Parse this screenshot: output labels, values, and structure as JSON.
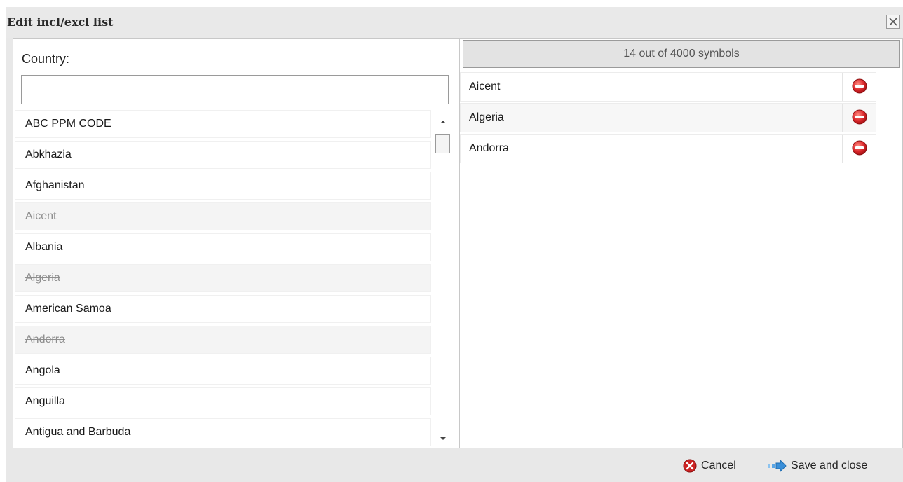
{
  "dialog": {
    "title": "Edit incl/excl list",
    "close_icon": "close-x-icon"
  },
  "left": {
    "filter_label": "Country:",
    "filter_value": "",
    "filter_placeholder": "",
    "items": [
      {
        "label": "ABC PPM CODE",
        "excluded": false
      },
      {
        "label": "Abkhazia",
        "excluded": false
      },
      {
        "label": "Afghanistan",
        "excluded": false
      },
      {
        "label": "Aicent",
        "excluded": true
      },
      {
        "label": "Albania",
        "excluded": false
      },
      {
        "label": "Algeria",
        "excluded": true
      },
      {
        "label": "American Samoa",
        "excluded": false
      },
      {
        "label": "Andorra",
        "excluded": true
      },
      {
        "label": "Angola",
        "excluded": false
      },
      {
        "label": "Anguilla",
        "excluded": false
      },
      {
        "label": "Antigua and Barbuda",
        "excluded": false
      }
    ]
  },
  "right": {
    "count_text": "14 out of 4000 symbols",
    "items": [
      {
        "label": "Aicent"
      },
      {
        "label": "Algeria"
      },
      {
        "label": "Andorra"
      }
    ],
    "remove_icon": "remove-minus-icon"
  },
  "footer": {
    "cancel_label": "Cancel",
    "save_label": "Save and close"
  },
  "colors": {
    "remove_red": "#d9262a",
    "cancel_red": "#cc2222",
    "save_blue": "#3a8fd9"
  }
}
